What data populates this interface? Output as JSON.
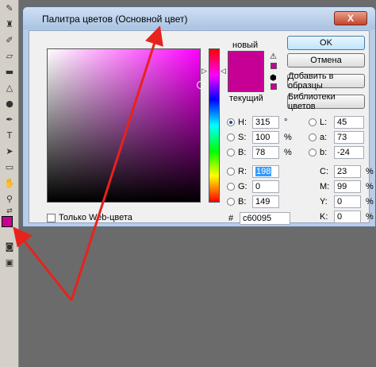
{
  "dialog": {
    "title": "Палитра цветов (Основной цвет)",
    "close_label": "X",
    "label_new": "новый",
    "label_current": "текущий",
    "new_color": "#c60095",
    "current_color": "#c60095"
  },
  "buttons": {
    "ok": "OK",
    "cancel": "Отмена",
    "add_swatches": "Добавить в образцы",
    "libraries": "Библиотеки цветов"
  },
  "hsb": [
    {
      "label": "H:",
      "value": "315",
      "unit": "°",
      "selected": true
    },
    {
      "label": "S:",
      "value": "100",
      "unit": "%",
      "selected": false
    },
    {
      "label": "B:",
      "value": "78",
      "unit": "%",
      "selected": false
    }
  ],
  "rgb": [
    {
      "label": "R:",
      "value": "198",
      "selected": false
    },
    {
      "label": "G:",
      "value": "0",
      "selected": false
    },
    {
      "label": "B:",
      "value": "149",
      "selected": false
    }
  ],
  "lab": [
    {
      "label": "L:",
      "value": "45"
    },
    {
      "label": "a:",
      "value": "73"
    },
    {
      "label": "b:",
      "value": "-24"
    }
  ],
  "cmyk": [
    {
      "label": "C:",
      "value": "23",
      "unit": "%"
    },
    {
      "label": "M:",
      "value": "99",
      "unit": "%"
    },
    {
      "label": "Y:",
      "value": "0",
      "unit": "%"
    },
    {
      "label": "K:",
      "value": "0",
      "unit": "%"
    }
  ],
  "hex": {
    "label": "#",
    "value": "c60095"
  },
  "web_only": {
    "label": "Только Web-цвета",
    "checked": false
  },
  "colors": {
    "foreground": "#c60095",
    "background": "#000000",
    "arrow": "#e8221c"
  },
  "icons": [
    "brush-icon",
    "stamp-icon",
    "history-brush-icon",
    "eraser-icon",
    "gradient-icon",
    "blur-icon",
    "dodge-icon",
    "pen-icon",
    "type-icon",
    "path-select-icon",
    "shape-icon",
    "hand-icon",
    "zoom-icon",
    "swap-colors-icon",
    "quick-mask-icon",
    "screen-mode-icon",
    "warning-icon",
    "cube-icon"
  ]
}
